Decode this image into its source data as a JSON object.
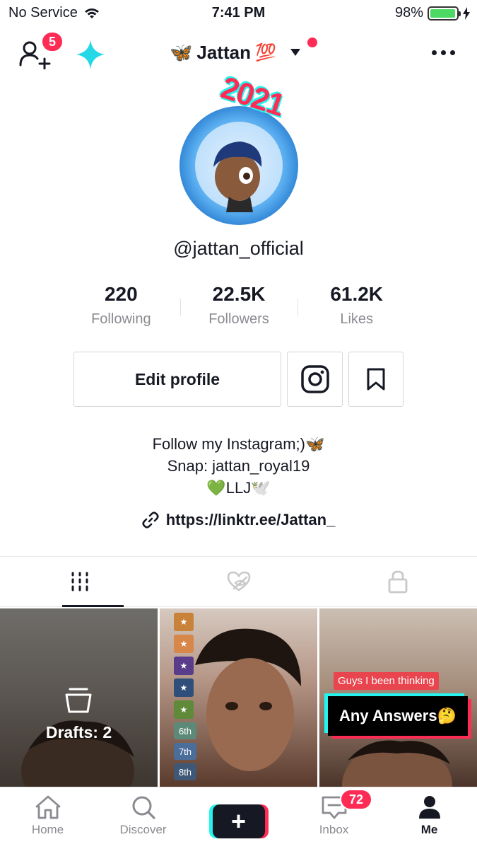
{
  "status_bar": {
    "carrier": "No Service",
    "time": "7:41 PM",
    "battery_percent": "98%",
    "battery_level": 0.98
  },
  "header": {
    "notification_count": "5",
    "account_name": "Jattan",
    "account_emoji": "💯",
    "account_butterfly": "🦋"
  },
  "profile": {
    "year_sticker": "2021",
    "username": "@jattan_official",
    "stats": [
      {
        "value": "220",
        "label": "Following"
      },
      {
        "value": "22.5K",
        "label": "Followers"
      },
      {
        "value": "61.2K",
        "label": "Likes"
      }
    ],
    "edit_label": "Edit profile",
    "bio_lines": [
      "Follow my Instagram;)🦋",
      "Snap: jattan_royal19",
      "💚LLJ🕊️"
    ],
    "link": "https://linktr.ee/Jattan_"
  },
  "tabs": [
    {
      "icon": "grid-icon",
      "active": true
    },
    {
      "icon": "liked-hidden-icon",
      "active": false
    },
    {
      "icon": "lock-icon",
      "active": false
    }
  ],
  "videos": {
    "drafts_label": "Drafts: 2",
    "ranks": [
      "6th",
      "7th",
      "8th"
    ],
    "caption_small": "Guys I been thinking",
    "caption_big": "Any Answers🤔"
  },
  "bottom_nav": {
    "items": [
      {
        "label": "Home",
        "icon": "home-icon"
      },
      {
        "label": "Discover",
        "icon": "search-icon"
      },
      {
        "label": "",
        "icon": "plus-icon"
      },
      {
        "label": "Inbox",
        "icon": "inbox-icon"
      },
      {
        "label": "Me",
        "icon": "profile-icon"
      }
    ],
    "inbox_badge": "72",
    "create_symbol": "+"
  },
  "colors": {
    "accent_red": "#fe2c55",
    "accent_cyan": "#25f4ee",
    "text_primary": "#161823",
    "text_secondary": "#8a8b91"
  }
}
